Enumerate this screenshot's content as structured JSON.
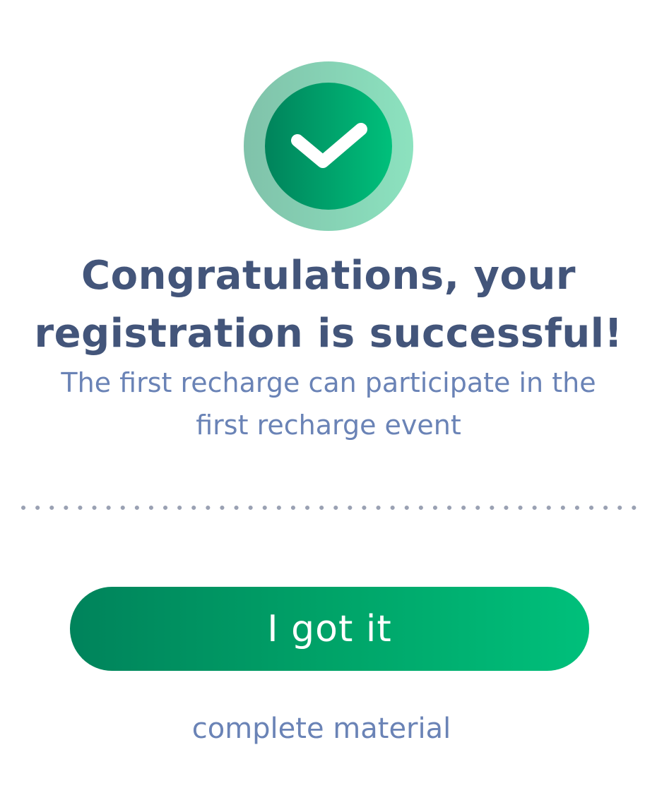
{
  "icon": {
    "name": "check-icon",
    "ring_color": "#85d9b4",
    "fill_start": "#00835b",
    "fill_end": "#00c07b"
  },
  "title": "Congratulations, your registration is successful!",
  "subtitle": "The first recharge can participate in the first recharge event",
  "primary_button": {
    "label": "I got it"
  },
  "secondary_link": {
    "label": "complete material"
  },
  "colors": {
    "title": "#43557a",
    "subtitle": "#6a83b6",
    "divider": "#9aa1b3",
    "button_start": "#00835b",
    "button_end": "#00c07b"
  }
}
